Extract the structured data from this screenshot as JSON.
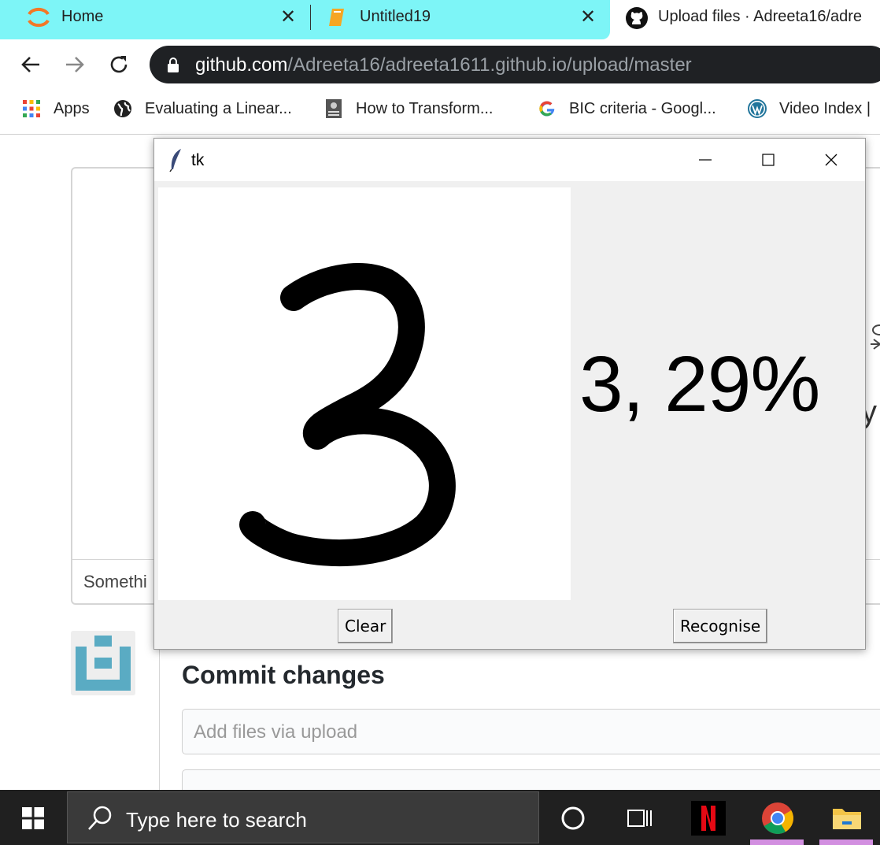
{
  "tabs": [
    {
      "label": "Home",
      "icon": "jupyter-icon"
    },
    {
      "label": "Untitled19",
      "icon": "notebook-icon"
    },
    {
      "label": "Upload files · Adreeta16/adre",
      "icon": "github-icon"
    }
  ],
  "toolbar": {
    "url_host": "github.com",
    "url_path": "/Adreeta16/adreeta1611.github.io/upload/master"
  },
  "bookmarks": [
    {
      "label": "Apps",
      "icon": "apps-grid-icon"
    },
    {
      "label": "Evaluating a Linear...",
      "icon": "globe-icon"
    },
    {
      "label": "How to Transform...",
      "icon": "book-thumbnail-icon"
    },
    {
      "label": "BIC criteria - Googl...",
      "icon": "google-icon"
    },
    {
      "label": "Video Index |",
      "icon": "wordpress-icon"
    }
  ],
  "page": {
    "dropzone_footer": "Somethi",
    "commit_title": "Commit changes",
    "commit_summary_placeholder": "Add files via upload",
    "right_partial": "y"
  },
  "tk": {
    "title": "tk",
    "result": "3, 29%",
    "clear_label": "Clear",
    "recognise_label": "Recognise"
  },
  "taskbar": {
    "search_placeholder": "Type here to search"
  },
  "colors": {
    "tab_active_bg": "#7df5f7",
    "omnibox_bg": "#1f2124",
    "taskbar_bg": "#202020",
    "identicon": "#5aabc3"
  }
}
